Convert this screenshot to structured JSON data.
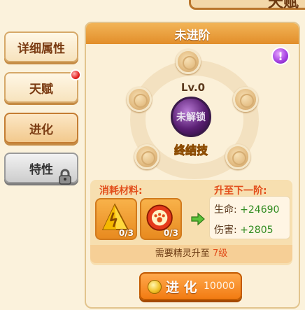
{
  "header": {
    "tab_partial": "天赋"
  },
  "sidebar": {
    "tabs": [
      {
        "label": "详细属性",
        "active": false
      },
      {
        "label": "天赋",
        "badge": true
      },
      {
        "label": "进化",
        "active": true
      },
      {
        "label": "特性",
        "locked": true
      }
    ]
  },
  "panel": {
    "title": "未进阶",
    "level": "Lv.0",
    "core_label": "未解锁",
    "skill_label": "终结技"
  },
  "materials": {
    "label": "消耗材料:",
    "items": [
      {
        "icon": "yellow-crystal-icon",
        "count": "0/3"
      },
      {
        "icon": "red-paw-orb-icon",
        "count": "0/3"
      }
    ]
  },
  "upgrade": {
    "label": "升至下一阶:",
    "stats": [
      {
        "name": "生命:",
        "value": "+24690"
      },
      {
        "name": "伤害:",
        "value": "+2805"
      }
    ]
  },
  "requirement": {
    "prefix": "需要精灵升至",
    "level": "7级"
  },
  "evolve_button": {
    "label": "进 化",
    "cost": "10000"
  },
  "colors": {
    "accent": "#f27b12",
    "highlight": "#e24d1a",
    "positive": "#2f8a1e"
  }
}
